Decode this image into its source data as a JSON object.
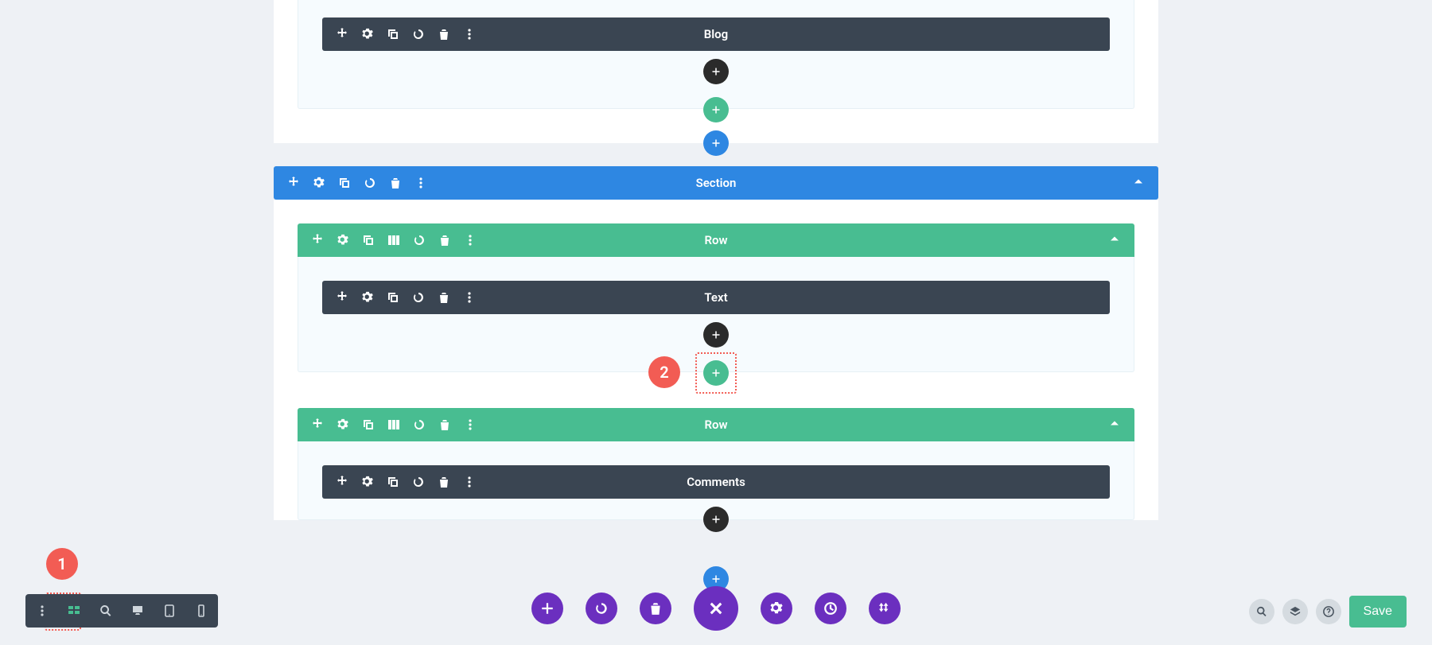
{
  "modules": {
    "blog": "Blog",
    "text": "Text",
    "comments": "Comments"
  },
  "labels": {
    "section": "Section",
    "row": "Row"
  },
  "callouts": {
    "c1": "1",
    "c2": "2"
  },
  "actions": {
    "save": "Save"
  }
}
